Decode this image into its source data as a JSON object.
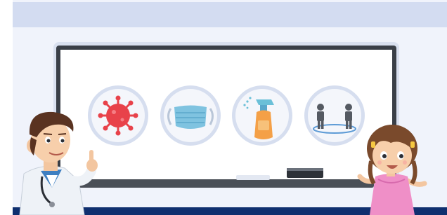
{
  "scene": {
    "colors": {
      "wall_band": "#d3dcf1",
      "wall": "#f0f3fb",
      "board_frame": "#3a3f47",
      "board_surface": "#ffffff",
      "icon_ring": "#d6deef",
      "floor": "#0f2f6f",
      "tray": "#4a4f57"
    },
    "icons": [
      {
        "name": "virus-icon",
        "color": "#e8424a"
      },
      {
        "name": "face-mask-icon",
        "color": "#7fc3e0"
      },
      {
        "name": "spray-bottle-icon",
        "color": "#f4a047"
      },
      {
        "name": "social-distancing-icon",
        "color": "#555a62"
      }
    ],
    "characters": [
      "doctor",
      "girl"
    ]
  }
}
